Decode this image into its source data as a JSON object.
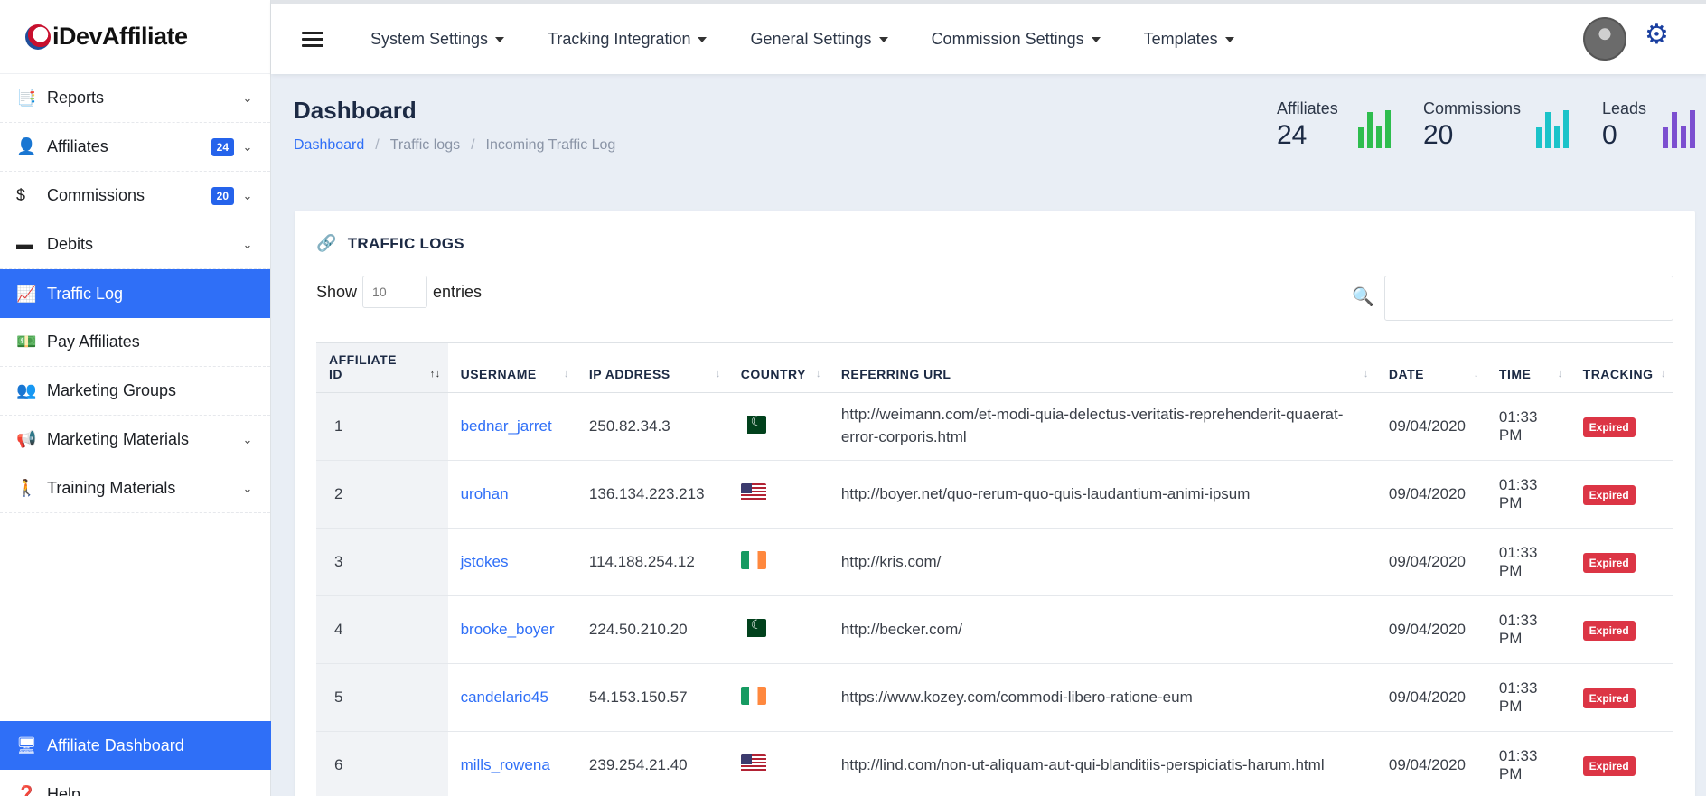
{
  "brand": {
    "name": "iDevAffiliate"
  },
  "sidebar": {
    "items": [
      {
        "label": "Reports",
        "icon": "reports-icon",
        "glyph": "📑",
        "chevron": true
      },
      {
        "label": "Affiliates",
        "icon": "user-icon",
        "glyph": "👤",
        "badge": "24",
        "chevron": true
      },
      {
        "label": "Commissions",
        "icon": "dollar-icon",
        "glyph": "$",
        "badge": "20",
        "chevron": true
      },
      {
        "label": "Debits",
        "icon": "credit-card-icon",
        "glyph": "▬",
        "chevron": true
      },
      {
        "label": "Traffic Log",
        "icon": "chart-line-icon",
        "glyph": "📈",
        "active": true
      },
      {
        "label": "Pay Affiliates",
        "icon": "money-icon",
        "glyph": "💵"
      },
      {
        "label": "Marketing Groups",
        "icon": "users-icon",
        "glyph": "👥"
      },
      {
        "label": "Marketing Materials",
        "icon": "megaphone-icon",
        "glyph": "📢",
        "chevron": true
      },
      {
        "label": "Training Materials",
        "icon": "walking-icon",
        "glyph": "🚶",
        "chevron": true
      }
    ],
    "bottom": [
      {
        "label": "Affiliate Dashboard",
        "icon": "desktop-icon",
        "glyph": "🖥",
        "active": true
      },
      {
        "label": "Help",
        "icon": "help-icon",
        "glyph": "❓"
      }
    ]
  },
  "topbar": {
    "menu": [
      "System Settings",
      "Tracking Integration",
      "General Settings",
      "Commission Settings",
      "Templates"
    ]
  },
  "page": {
    "title": "Dashboard",
    "breadcrumb": [
      "Dashboard",
      "Traffic logs",
      "Incoming Traffic Log"
    ]
  },
  "stats": [
    {
      "label": "Affiliates",
      "value": "24",
      "color": "#2ebd4e",
      "bars": [
        0.55,
        0.95,
        0.6,
        1.0
      ]
    },
    {
      "label": "Commissions",
      "value": "20",
      "color": "#1bc3c9",
      "bars": [
        0.55,
        0.95,
        0.6,
        1.0
      ]
    },
    {
      "label": "Leads",
      "value": "0",
      "color": "#7c4fd0",
      "bars": [
        0.55,
        0.95,
        0.6,
        1.0
      ]
    }
  ],
  "card": {
    "title": "TRAFFIC LOGS",
    "show_label": "Show",
    "entries_label": "entries",
    "page_size": "10"
  },
  "table": {
    "columns": [
      "AFFILIATE ID",
      "USERNAME",
      "IP ADDRESS",
      "COUNTRY",
      "REFERRING URL",
      "DATE",
      "TIME",
      "TRACKING"
    ],
    "rows": [
      {
        "id": "1",
        "username": "bednar_jarret",
        "ip": "250.82.34.3",
        "country": "pk",
        "url": "http://weimann.com/et-modi-quia-delectus-veritatis-reprehenderit-quaerat-error-corporis.html",
        "date": "09/04/2020",
        "time": "01:33 PM",
        "tracking": "Expired"
      },
      {
        "id": "2",
        "username": "urohan",
        "ip": "136.134.223.213",
        "country": "us",
        "url": "http://boyer.net/quo-rerum-quo-quis-laudantium-animi-ipsum",
        "date": "09/04/2020",
        "time": "01:33 PM",
        "tracking": "Expired"
      },
      {
        "id": "3",
        "username": "jstokes",
        "ip": "114.188.254.12",
        "country": "ie",
        "url": "http://kris.com/",
        "date": "09/04/2020",
        "time": "01:33 PM",
        "tracking": "Expired"
      },
      {
        "id": "4",
        "username": "brooke_boyer",
        "ip": "224.50.210.20",
        "country": "pk",
        "url": "http://becker.com/",
        "date": "09/04/2020",
        "time": "01:33 PM",
        "tracking": "Expired"
      },
      {
        "id": "5",
        "username": "candelario45",
        "ip": "54.153.150.57",
        "country": "ie",
        "url": "https://www.kozey.com/commodi-libero-ratione-eum",
        "date": "09/04/2020",
        "time": "01:33 PM",
        "tracking": "Expired"
      },
      {
        "id": "6",
        "username": "mills_rowena",
        "ip": "239.254.21.40",
        "country": "us",
        "url": "http://lind.com/non-ut-aliquam-aut-qui-blanditiis-perspiciatis-harum.html",
        "date": "09/04/2020",
        "time": "01:33 PM",
        "tracking": "Expired"
      }
    ]
  }
}
